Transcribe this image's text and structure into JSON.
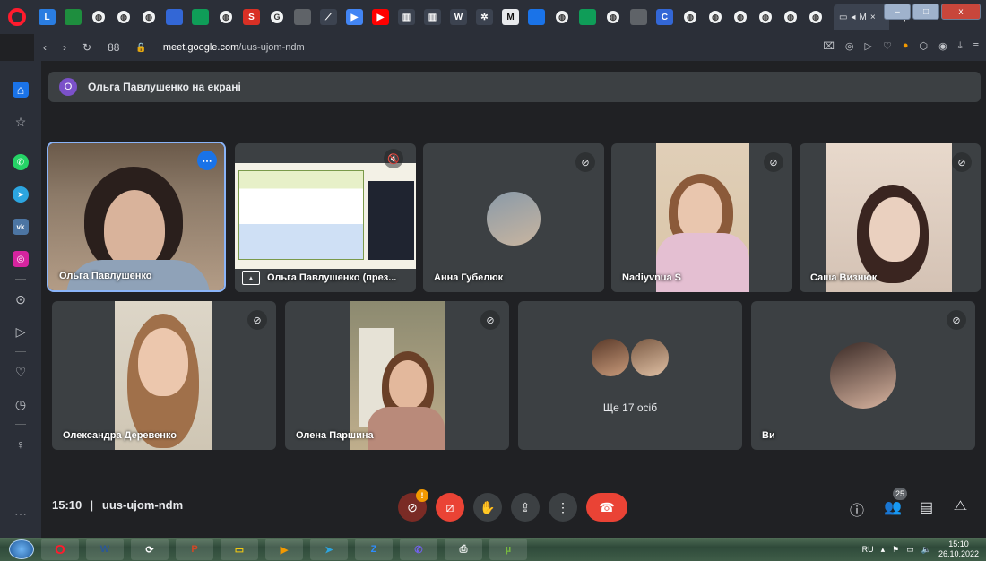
{
  "browser": {
    "tabs": [
      "L",
      "",
      "",
      "",
      "",
      "",
      "",
      "",
      "",
      "S",
      "",
      "",
      "",
      "",
      "",
      "",
      "",
      "",
      "",
      "W",
      "",
      "M",
      "",
      "",
      "",
      "",
      "",
      "",
      "",
      "",
      "",
      "",
      "",
      "",
      "",
      "",
      ""
    ],
    "active_tab_label": "M",
    "new_tab_label": "+",
    "search_glyph": "⌕",
    "url_host": "meet.google.com",
    "url_path": "/uus-ujom-ndm",
    "nav_back": "‹",
    "nav_forward": "›",
    "nav_reload": "↻",
    "grid_label": "88",
    "lock": "🔒",
    "win_minimize": "–",
    "win_maximize": "□",
    "win_close": "x"
  },
  "banner": {
    "avatar_letter": "О",
    "text": "Ольга Павлушенко на екрані"
  },
  "tiles": [
    {
      "name": "Ольга Павлушенко"
    },
    {
      "name": "Ольга Павлушенко (през..."
    },
    {
      "name": "Анна Губелюк"
    },
    {
      "name": "Nadiyvnua S"
    },
    {
      "name": "Саша Визнюк"
    },
    {
      "name": "Олександра Деревенко"
    },
    {
      "name": "Олена Паршина"
    },
    {
      "name": "Ще 17 осіб"
    },
    {
      "name": "Ви"
    }
  ],
  "meeting": {
    "time": "15:10",
    "separator": "|",
    "code": "uus-ujom-ndm",
    "mic_warning": "!",
    "participants_count": "25"
  },
  "taskbar": {
    "language": "RU",
    "time": "15:10",
    "date": "26.10.2022"
  },
  "colors": {
    "meet_background": "#202124",
    "tile_background": "#3c4043",
    "end_call": "#ea4335",
    "active_speaker": "#8ab4f8",
    "opera_red": "#ff1b2d"
  },
  "icons": [
    "opera-logo",
    "whatsapp-icon",
    "telegram-icon",
    "vk-icon",
    "instagram-icon",
    "mic-off-icon",
    "camera-off-icon",
    "raise-hand-icon",
    "present-icon",
    "more-options-icon",
    "end-call-icon",
    "info-icon",
    "people-icon",
    "chat-icon",
    "activities-icon"
  ]
}
